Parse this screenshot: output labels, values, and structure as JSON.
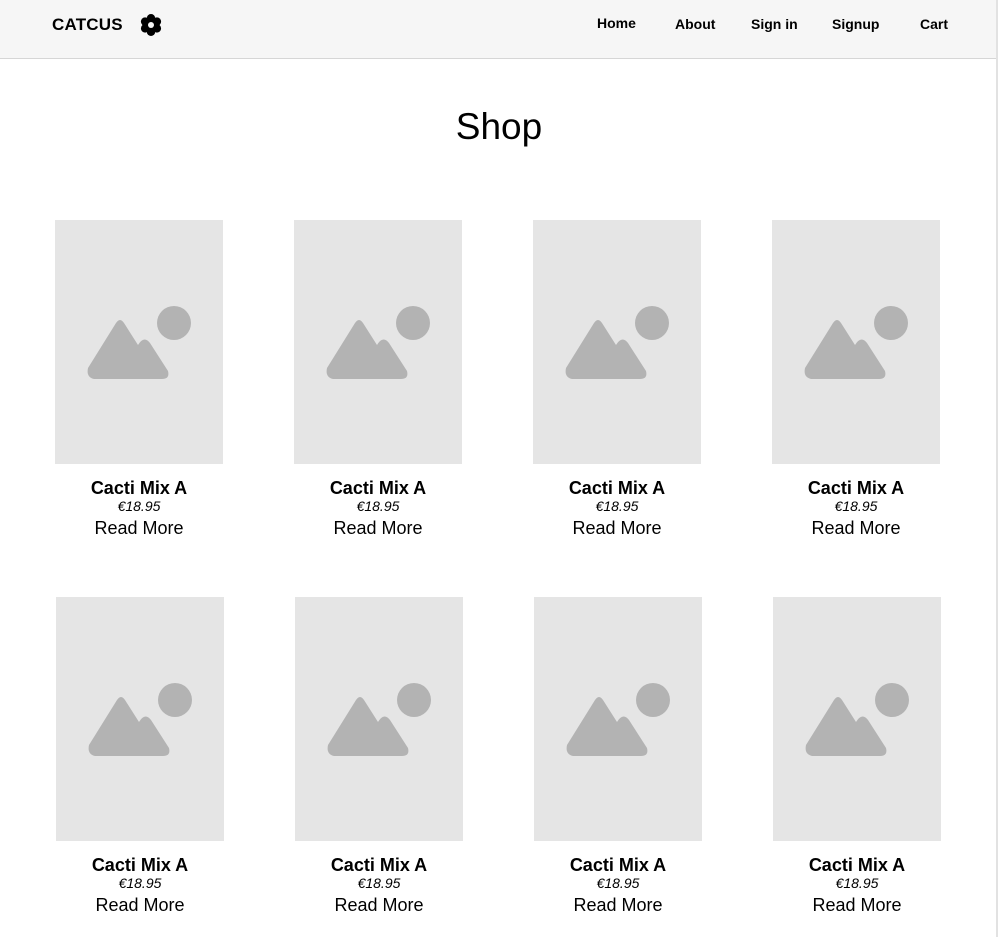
{
  "header": {
    "brand": "CATCUS",
    "brand_icon": "flower-icon",
    "nav": {
      "home": "Home",
      "about": "About",
      "signin": "Sign in",
      "signup": "Signup",
      "cart": "Cart"
    }
  },
  "main": {
    "title": "Shop",
    "placeholder_icon": "image-placeholder-icon",
    "products": [
      {
        "name": "Cacti Mix A",
        "price": "€18.95",
        "link": "Read More"
      },
      {
        "name": "Cacti Mix A",
        "price": "€18.95",
        "link": "Read More"
      },
      {
        "name": "Cacti Mix A",
        "price": "€18.95",
        "link": "Read More"
      },
      {
        "name": "Cacti Mix A",
        "price": "€18.95",
        "link": "Read More"
      },
      {
        "name": "Cacti Mix A",
        "price": "€18.95",
        "link": "Read More"
      },
      {
        "name": "Cacti Mix A",
        "price": "€18.95",
        "link": "Read More"
      },
      {
        "name": "Cacti Mix A",
        "price": "€18.95",
        "link": "Read More"
      },
      {
        "name": "Cacti Mix A",
        "price": "€18.95",
        "link": "Read More"
      }
    ]
  },
  "colors": {
    "header_bg": "#f6f6f6",
    "placeholder_bg": "#e5e5e5",
    "placeholder_icon": "#b3b3b3"
  }
}
